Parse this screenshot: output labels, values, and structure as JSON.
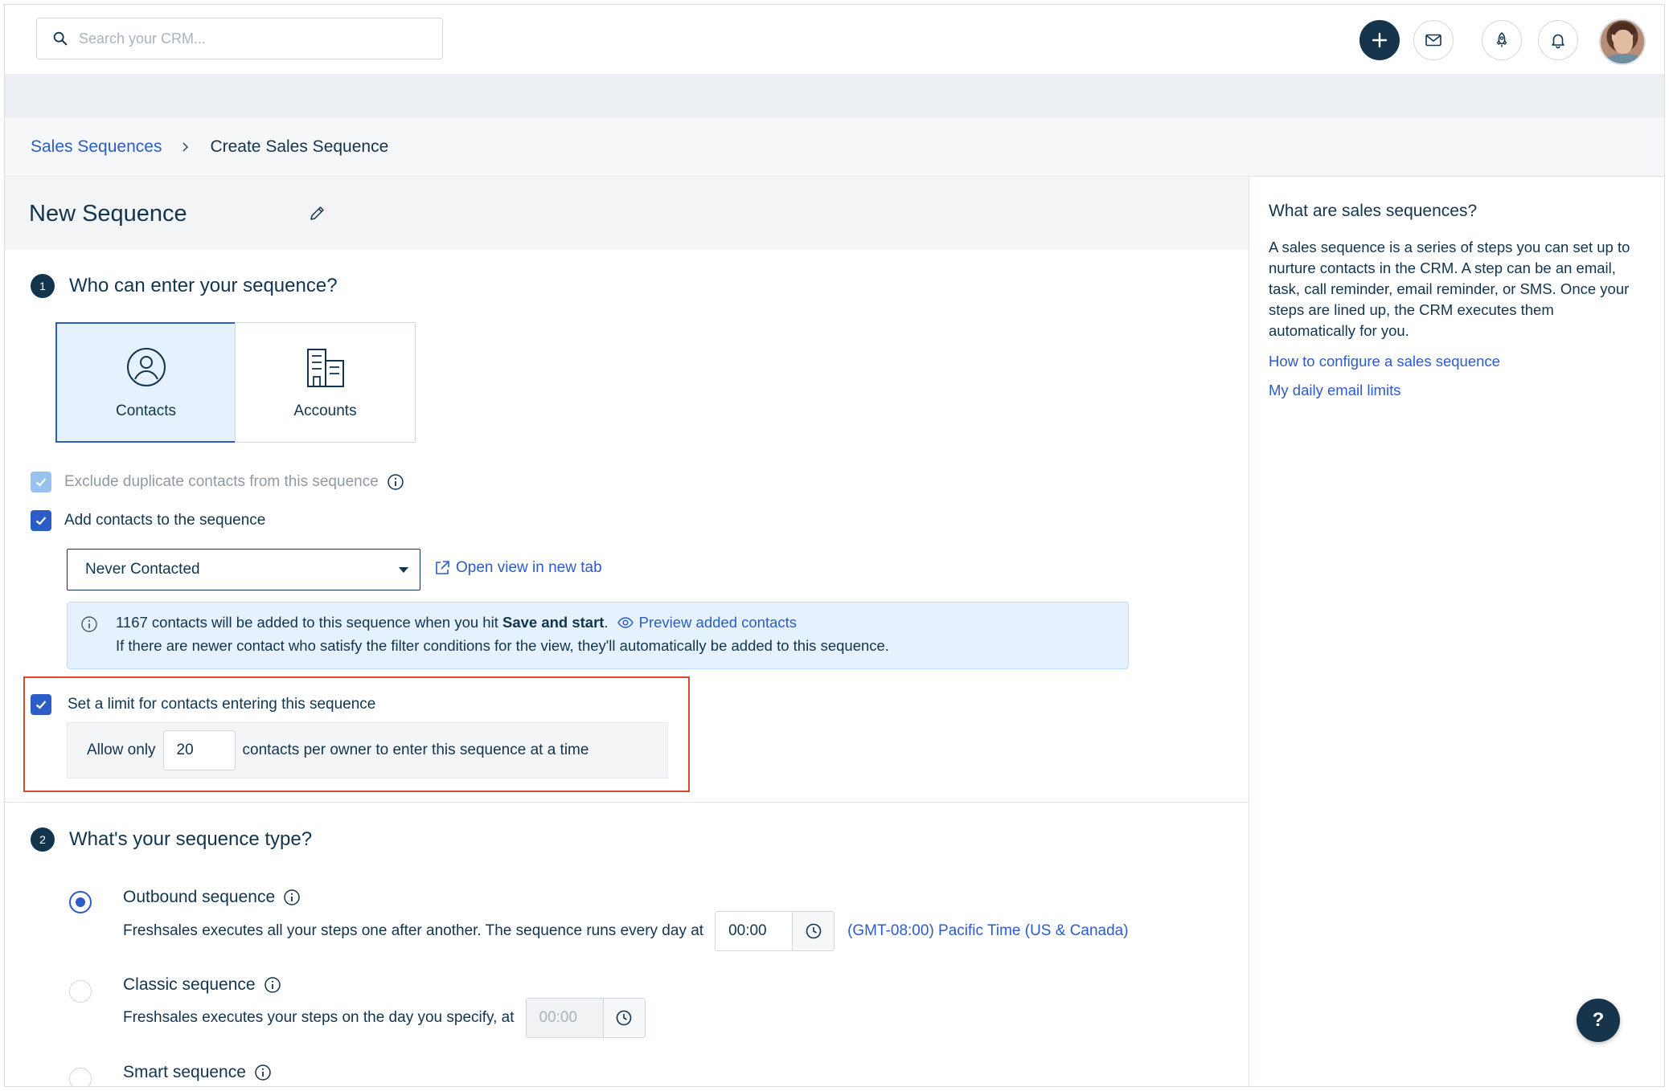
{
  "header": {
    "search_placeholder": "Search your CRM...",
    "icons": [
      "search-icon",
      "plus-icon",
      "mail-icon",
      "rocket-icon",
      "bell-icon",
      "avatar"
    ]
  },
  "breadcrumb": {
    "parent": "Sales Sequences",
    "current": "Create Sales Sequence"
  },
  "sequence": {
    "title": "New Sequence"
  },
  "section1": {
    "number": "1",
    "title": "Who can enter your sequence?",
    "entities": [
      {
        "label": "Contacts",
        "selected": true
      },
      {
        "label": "Accounts",
        "selected": false
      }
    ],
    "exclude_duplicates_label": "Exclude duplicate contacts from this sequence",
    "add_contacts_label": "Add contacts to the sequence",
    "view_select_value": "Never Contacted",
    "open_view_link": "Open view in new tab",
    "info": {
      "count_text": "1167 contacts will be added to this sequence when you hit",
      "bold_text": "Save and start",
      "period": ".",
      "preview_link": "Preview added contacts",
      "line2": "If there are newer contact who satisfy the filter conditions for the view, they'll automatically be added to this sequence."
    },
    "limit": {
      "checkbox_label": "Set a limit for contacts entering this sequence",
      "prefix": "Allow only",
      "value": "20",
      "suffix": "contacts per owner to enter this sequence at a time"
    }
  },
  "section2": {
    "number": "2",
    "title": "What's your sequence type?",
    "options": [
      {
        "title": "Outbound sequence",
        "selected": true,
        "desc": "Freshsales executes all your steps one after another. The sequence runs every day at",
        "time": "00:00",
        "timezone": "(GMT-08:00) Pacific Time (US & Canada)"
      },
      {
        "title": "Classic sequence",
        "selected": false,
        "desc": "Freshsales executes your steps on the day you specify, at",
        "time": "00:00"
      },
      {
        "title": "Smart sequence",
        "selected": false
      }
    ]
  },
  "sidebar": {
    "title": "What are sales sequences?",
    "body": "A sales sequence is a series of steps you can set up to nurture contacts in the CRM. A step can be an email, task, call reminder, email reminder, or SMS. Once your steps are lined up, the CRM executes them automatically for you.",
    "links": [
      "How to configure a sales sequence",
      "My daily email limits"
    ]
  },
  "help_button": "?",
  "colors": {
    "primary_blue": "#2c5cc5",
    "navy": "#12344d",
    "highlight_red": "#d44a2a",
    "info_bg": "#e5f2fd"
  }
}
